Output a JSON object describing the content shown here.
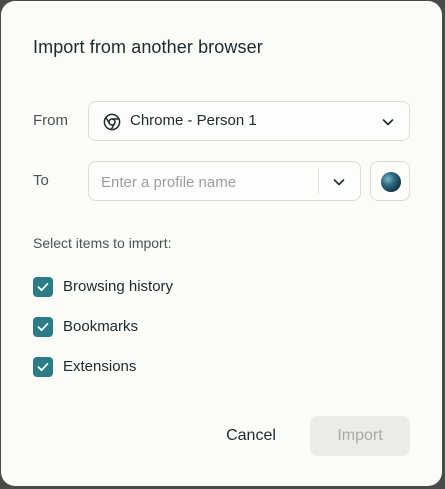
{
  "dialog": {
    "title": "Import from another browser"
  },
  "from": {
    "label": "From",
    "selected": "Chrome - Person 1",
    "icon": "chrome-icon"
  },
  "to": {
    "label": "To",
    "placeholder": "Enter a profile name",
    "value": "",
    "avatar_icon": "profile-avatar-icon"
  },
  "items": {
    "heading": "Select items to import:",
    "list": [
      {
        "label": "Browsing history",
        "checked": true
      },
      {
        "label": "Bookmarks",
        "checked": true
      },
      {
        "label": "Extensions",
        "checked": true
      }
    ]
  },
  "actions": {
    "cancel_label": "Cancel",
    "import_label": "Import",
    "import_enabled": false
  },
  "colors": {
    "accent": "#2a7c86",
    "background": "#fbfbf8",
    "text": "#1d2a2e",
    "muted": "#4a5457"
  }
}
